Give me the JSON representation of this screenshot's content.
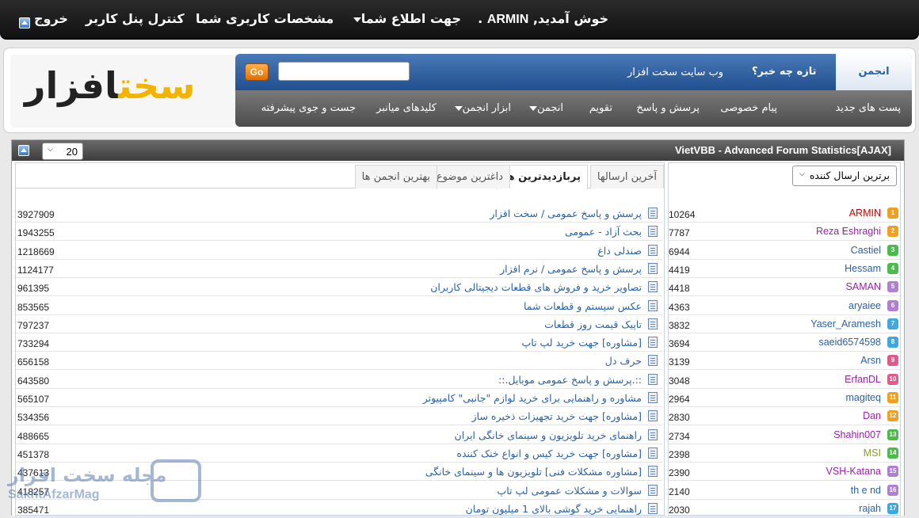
{
  "topbar": {
    "welcome_prefix": "خوش آمدید,",
    "username": "ARMIN",
    "notif_label": "جهت اطلاع شما",
    "profile_label": "مشخصات کاربری شما",
    "panel_label": "کنترل پنل کاربر",
    "logout_label": "خروج"
  },
  "header": {
    "logo_text_dark": "افزار",
    "logo_text_yellow": "سخت",
    "go_label": "Go",
    "search_placeholder": "",
    "site_label": "وب سایت سخت افزار",
    "whats_new": "تازه چه خبر؟",
    "forum_tab": "انجمن",
    "nav": [
      "پست های جدید",
      "پیام خصوصی",
      "پرسش و پاسخ",
      "تقویم",
      "انجمن",
      "ابزار انجمن",
      "کلیدهای میانبر",
      "جست و جوی پیشرفته"
    ]
  },
  "stats": {
    "title": "VietVBB - Advanced Forum Statistics[AJAX]",
    "limit_value": "20",
    "tabs": [
      "آخرین ارسالها",
      "پربازدیدترین ها",
      "داغترین موضوع",
      "بهترین انجمن ها"
    ],
    "active_tab": "پربازدیدترین ها",
    "poster_select": "برترین ارسال کننده",
    "threads": [
      {
        "title": "پرسش و پاسخ عمومی / سخت افزار",
        "views": "3927909"
      },
      {
        "title": "بحث آزاد - عمومی",
        "views": "1943255"
      },
      {
        "title": "صندلی داغ",
        "views": "1218669"
      },
      {
        "title": "پرسش و پاسخ عمومی / نرم افزار",
        "views": "1124177"
      },
      {
        "title": "تصاویر خرید و فروش های قطعات دیجیتالی کاربران",
        "views": "961395"
      },
      {
        "title": "عکس سیستم و قطعات شما",
        "views": "853565"
      },
      {
        "title": "تاپیک قیمت روز قطعات",
        "views": "797237"
      },
      {
        "title": "[مشاوره] جهت خرید لپ تاپ",
        "views": "733294"
      },
      {
        "title": "حرف دل",
        "views": "656158"
      },
      {
        "title": "::.پرسش و پاسخ عمومی موبایل.::",
        "views": "643580"
      },
      {
        "title": "مشاوره و راهنمایی برای خرید لوازم \"جانبی\" کامپیوتر",
        "views": "565107"
      },
      {
        "title": "[مشاوره] جهت خرید تجهیزات ذخیره ساز",
        "views": "534356"
      },
      {
        "title": "راهنمای خرید تلویزیون و سینمای خانگی ایران",
        "views": "488665"
      },
      {
        "title": "[مشاوره] جهت خرید کیس و انواع خنک کننده",
        "views": "451378"
      },
      {
        "title": "[مشاوره مشکلات فنی] تلویزیون ها و سینمای خانگی",
        "views": "437613"
      },
      {
        "title": "سوالات و مشکلات عمومی لپ تاپ",
        "views": "418257"
      },
      {
        "title": "راهنمایی خرید گوشی بالای 1 میلیون تومان",
        "views": "385471"
      }
    ],
    "posters": [
      {
        "rank": "1",
        "name": "ARMIN",
        "posts": "10264",
        "color": "#cc0000",
        "badge": "#f0a020"
      },
      {
        "rank": "2",
        "name": "Reza Eshraghi",
        "posts": "7787",
        "color": "#9a1fb0",
        "badge": "#f0a020"
      },
      {
        "rank": "3",
        "name": "Castiel",
        "posts": "6944",
        "color": "#2a62a8",
        "badge": "#4cbb4c"
      },
      {
        "rank": "4",
        "name": "Hessam",
        "posts": "4419",
        "color": "#2a62a8",
        "badge": "#4cbb4c"
      },
      {
        "rank": "5",
        "name": "SAMAN",
        "posts": "4418",
        "color": "#9a1fb0",
        "badge": "#b07fd0"
      },
      {
        "rank": "6",
        "name": "aryaiee",
        "posts": "4363",
        "color": "#2a62a8",
        "badge": "#b07fd0"
      },
      {
        "rank": "7",
        "name": "Yaser_Aramesh",
        "posts": "3832",
        "color": "#2a62a8",
        "badge": "#3fa8e0"
      },
      {
        "rank": "8",
        "name": "saeid6574598",
        "posts": "3694",
        "color": "#2a62a8",
        "badge": "#3fa8e0"
      },
      {
        "rank": "9",
        "name": "Arsn",
        "posts": "3139",
        "color": "#2a62a8",
        "badge": "#e05a8a"
      },
      {
        "rank": "10",
        "name": "ErfanDL",
        "posts": "3048",
        "color": "#9a1fb0",
        "badge": "#e05a8a"
      },
      {
        "rank": "11",
        "name": "magiteq",
        "posts": "2964",
        "color": "#2a62a8",
        "badge": "#f0a020"
      },
      {
        "rank": "12",
        "name": "Dan",
        "posts": "2830",
        "color": "#9a1fb0",
        "badge": "#f0a020"
      },
      {
        "rank": "13",
        "name": "Shahin007",
        "posts": "2734",
        "color": "#9a1fb0",
        "badge": "#4cbb4c"
      },
      {
        "rank": "14",
        "name": "MSI",
        "posts": "2398",
        "color": "#8aa020",
        "badge": "#4cbb4c"
      },
      {
        "rank": "15",
        "name": "VSH-Katana",
        "posts": "2390",
        "color": "#9a1fb0",
        "badge": "#b07fd0"
      },
      {
        "rank": "16",
        "name": "th e nd",
        "posts": "2140",
        "color": "#2a62a8",
        "badge": "#b07fd0"
      },
      {
        "rank": "17",
        "name": "rajah",
        "posts": "2030",
        "color": "#2a62a8",
        "badge": "#3fa8e0"
      }
    ]
  },
  "watermark": {
    "text": "مجله سخت افزار",
    "sub": "SakhtAfzarMag"
  }
}
